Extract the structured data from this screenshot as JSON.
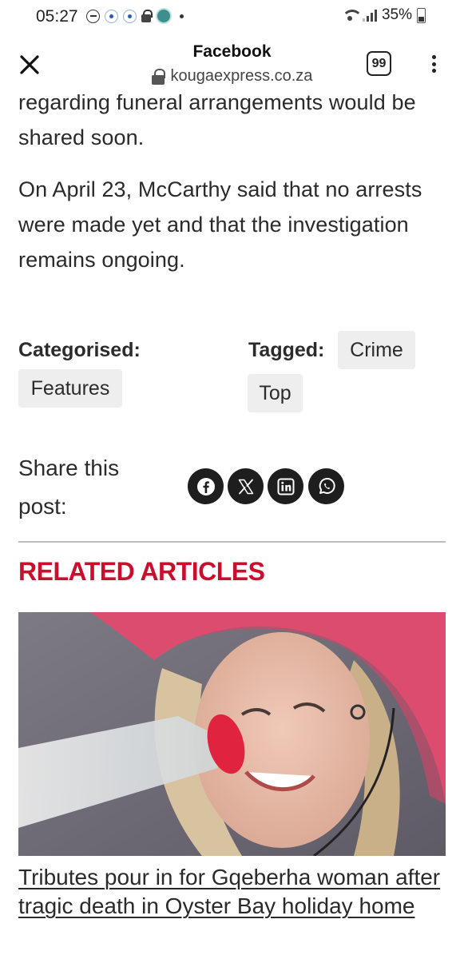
{
  "status_bar": {
    "time": "05:27",
    "battery": "35%",
    "icons": [
      "do-not-disturb-icon",
      "notification-dot-icon",
      "notification-dot-icon",
      "lock-icon",
      "tree-app-icon",
      "more-dot-icon",
      "wifi-icon",
      "signal-icon",
      "battery-icon"
    ]
  },
  "browser": {
    "title": "Facebook",
    "url": "kougaexpress.co.za",
    "tab_count": "99"
  },
  "article": {
    "paragraph_1": "regarding funeral arrangements would be shared soon.",
    "paragraph_2": "On April 23, McCarthy said that no arrests were made yet and that the investigation remains ongoing."
  },
  "meta": {
    "categorised_label": "Categorised:",
    "categories": [
      "Features"
    ],
    "tagged_label": "Tagged:",
    "tags": [
      "Crime",
      "Top"
    ]
  },
  "share": {
    "label": "Share this post:",
    "buttons": [
      "facebook-icon",
      "x-icon",
      "linkedin-icon",
      "whatsapp-icon"
    ]
  },
  "related": {
    "heading": "RELATED ARTICLES",
    "article_title": "Tributes pour in for Gqeberha woman after tragic death in Oyster Bay holiday home"
  },
  "colors": {
    "accent_red": "#c8102e",
    "chip_bg": "#eeeeee",
    "share_button_bg": "#1e1e1e"
  }
}
